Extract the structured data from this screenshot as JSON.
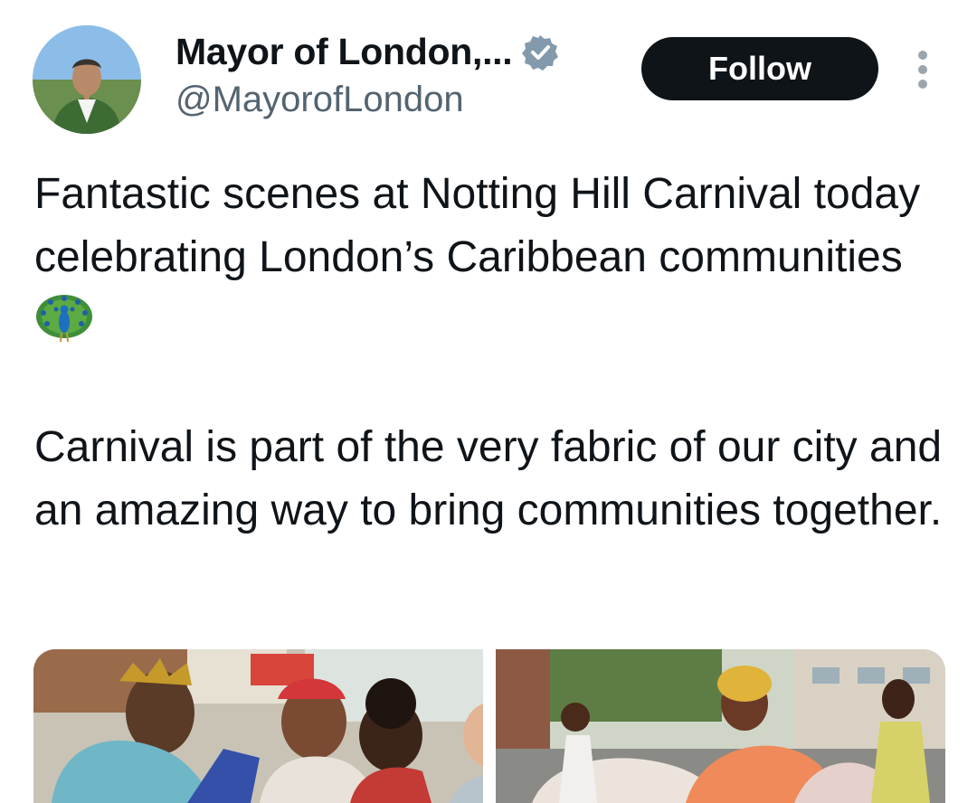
{
  "author": {
    "display_name": "Mayor of London,...",
    "handle": "@MayorofLondon",
    "verified_icon": "verified-badge-icon",
    "avatar": "avatar-photo"
  },
  "actions": {
    "follow_label": "Follow",
    "more_icon": "more-options-icon"
  },
  "tweet": {
    "paragraph_1": "Fantastic scenes at Notting Hill Carnival today celebrating London’s Caribbean communities",
    "emoji": "peacock-emoji",
    "paragraph_2": "Carnival is part of the very fabric of our city and an amazing way to bring communities together."
  },
  "media": [
    {
      "name": "carnival-photo-1"
    },
    {
      "name": "carnival-photo-2"
    }
  ],
  "colors": {
    "text": "#0f1419",
    "secondary": "#536471",
    "button_bg": "#0f1419",
    "verified": "#829aab"
  }
}
